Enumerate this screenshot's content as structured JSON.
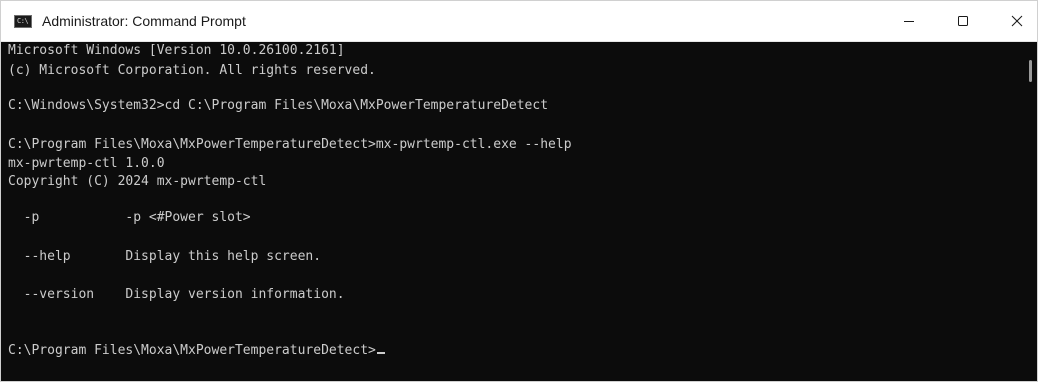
{
  "window": {
    "title": "Administrator: Command Prompt",
    "icon": "command-prompt-icon",
    "icon_glyph": "C:\\",
    "controls": {
      "minimize": "minimize-icon",
      "maximize": "maximize-icon",
      "close": "close-icon"
    }
  },
  "terminal": {
    "lines": [
      "Microsoft Windows [Version 10.0.26100.2161]",
      "(c) Microsoft Corporation. All rights reserved.",
      "C:\\Windows\\System32>cd C:\\Program Files\\Moxa\\MxPowerTemperatureDetect",
      "C:\\Program Files\\Moxa\\MxPowerTemperatureDetect>mx-pwrtemp-ctl.exe --help",
      "mx-pwrtemp-ctl 1.0.0",
      "Copyright (C) 2024 mx-pwrtemp-ctl",
      "  -p           -p <#Power slot>",
      "  --help       Display this help screen.",
      "  --version    Display version information.",
      "C:\\Program Files\\Moxa\\MxPowerTemperatureDetect>"
    ]
  },
  "colors": {
    "background": "#0c0c0c",
    "text": "#cccccc",
    "titlebar": "#ffffff"
  }
}
